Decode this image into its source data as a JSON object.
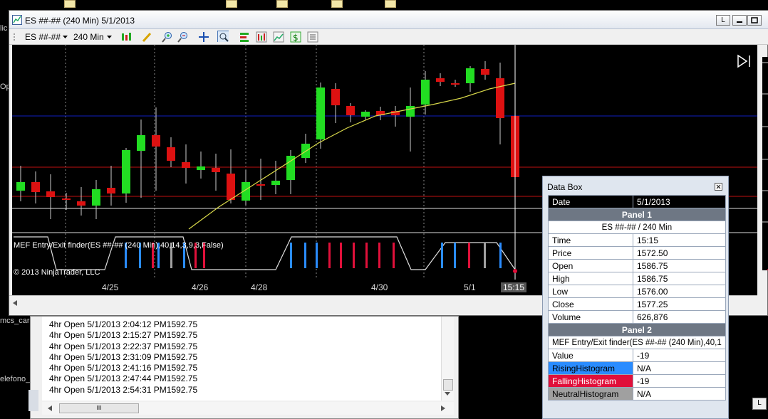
{
  "desktop": {
    "left_labels": [
      "mcs_card",
      "elefono_te"
    ],
    "left_fragments": [
      "lic",
      "Op"
    ]
  },
  "chart_window": {
    "title": "ES ##-## (240 Min)  5/1/2013",
    "buttons": [
      "L",
      "minimize",
      "maximize",
      "close"
    ],
    "toolbar": {
      "instrument": "ES ##-##",
      "interval": "240 Min",
      "icons": [
        "bars-style-icon",
        "pencil-draw-icon",
        "zoom-in-icon",
        "zoom-out-icon",
        "crosshair-icon",
        "magnifier-icon",
        "strategies-icon",
        "indicators-icon",
        "chart-trader-icon",
        "dollar-icon",
        "properties-icon"
      ]
    },
    "indicator_label": "MEF Entry/Exit finder(ES ##-## (240 Min),40,14,3,9,3,False)",
    "copyright": "© 2013 NinjaTrader, LLC",
    "x_labels": [
      "4/25",
      "4/26",
      "4/28",
      "4/30",
      "5/1",
      "15:15"
    ],
    "colors": {
      "up": "#22dd22",
      "down": "#dd1111",
      "sma": "#d8d84a",
      "blue_line": "#1020c0",
      "red_line": "#c01010",
      "hist_blue": "#2a8cff",
      "hist_red": "#e0103a",
      "hist_gray": "#a0a0a0"
    }
  },
  "output_window": {
    "lines": [
      "4hr Open 5/1/2013 2:04:12 PM1592.75",
      "4hr Open 5/1/2013 2:15:27 PM1592.75",
      "4hr Open 5/1/2013 2:22:37 PM1592.75",
      "4hr Open 5/1/2013 2:31:09 PM1592.75",
      "4hr Open 5/1/2013 2:41:16 PM1592.75",
      "4hr Open 5/1/2013 2:47:44 PM1592.75",
      "4hr Open 5/1/2013 2:54:31 PM1592.75"
    ]
  },
  "data_box": {
    "title": "Data Box",
    "date": {
      "label": "Date",
      "value": "5/1/2013"
    },
    "panel1": {
      "header": "Panel 1",
      "sub": "ES ##-## / 240 Min",
      "rows": [
        {
          "label": "Time",
          "value": "15:15"
        },
        {
          "label": "Price",
          "value": "1572.50"
        },
        {
          "label": "Open",
          "value": "1586.75"
        },
        {
          "label": "High",
          "value": "1586.75"
        },
        {
          "label": "Low",
          "value": "1576.00"
        },
        {
          "label": "Close",
          "value": "1577.25"
        },
        {
          "label": "Volume",
          "value": "626,876"
        }
      ]
    },
    "panel2": {
      "header": "Panel 2",
      "sub": "MEF Entry/Exit finder(ES ##-## (240 Min),40,1",
      "rows": [
        {
          "label": "Value",
          "value": "-19",
          "color": "#ffffff"
        },
        {
          "label": "RisingHistogram",
          "value": "N/A",
          "color": "#2a8cff"
        },
        {
          "label": "FallingHistogram",
          "value": "-19",
          "color": "#e0103a"
        },
        {
          "label": "NeutralHistogram",
          "value": "N/A",
          "color": "#a0a0a0"
        }
      ]
    }
  }
}
